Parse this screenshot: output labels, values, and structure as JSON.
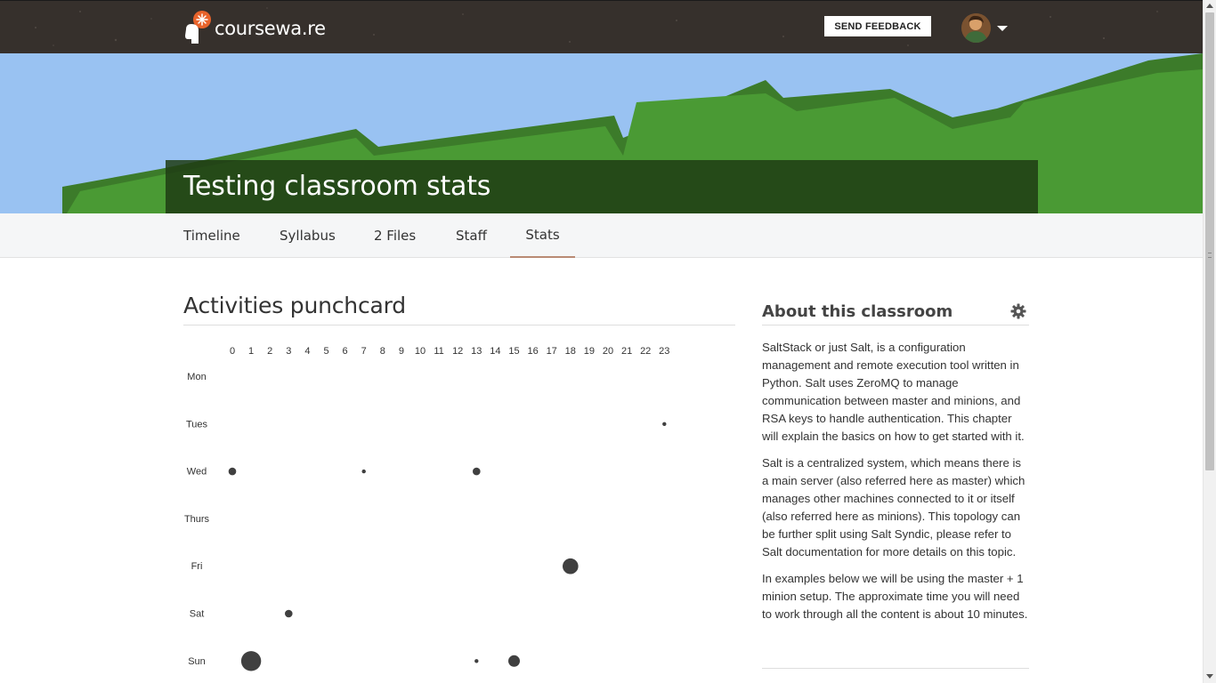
{
  "header": {
    "brand": "coursewa.re",
    "feedback_label": "SEND FEEDBACK",
    "brand_color": "#36302c",
    "accent_color": "#e8632b"
  },
  "hero": {
    "title": "Testing classroom stats"
  },
  "tabs": [
    {
      "label": "Timeline"
    },
    {
      "label": "Syllabus"
    },
    {
      "label": "2 Files"
    },
    {
      "label": "Staff"
    },
    {
      "label": "Stats",
      "active": true
    }
  ],
  "punchcard": {
    "title": "Activities punchcard"
  },
  "chart_data": {
    "type": "scatter",
    "title": "Activities punchcard",
    "x_ticks": [
      "0",
      "1",
      "2",
      "3",
      "4",
      "5",
      "6",
      "7",
      "8",
      "9",
      "10",
      "11",
      "12",
      "13",
      "14",
      "15",
      "16",
      "17",
      "18",
      "19",
      "20",
      "21",
      "22",
      "23"
    ],
    "y_labels": [
      "Mon",
      "Tues",
      "Wed",
      "Thurs",
      "Fri",
      "Sat",
      "Sun"
    ],
    "points": [
      {
        "day": "Tues",
        "hour": 23,
        "size": 1
      },
      {
        "day": "Wed",
        "hour": 0,
        "size": 2
      },
      {
        "day": "Wed",
        "hour": 7,
        "size": 1
      },
      {
        "day": "Wed",
        "hour": 13,
        "size": 2
      },
      {
        "day": "Fri",
        "hour": 18,
        "size": 4
      },
      {
        "day": "Sat",
        "hour": 3,
        "size": 2
      },
      {
        "day": "Sun",
        "hour": 1,
        "size": 5
      },
      {
        "day": "Sun",
        "hour": 13,
        "size": 1
      },
      {
        "day": "Sun",
        "hour": 15,
        "size": 3
      }
    ],
    "dot_color": "#404040"
  },
  "about": {
    "title": "About this classroom",
    "paragraphs": [
      "SaltStack or just Salt, is a configuration management and remote execution tool written in Python. Salt uses ZeroMQ to manage communication between master and minions, and RSA keys to handle authentication. This chapter will explain the basics on how to get started with it.",
      "Salt is a centralized system, which means there is a main server (also referred here as master) which manages other machines connected to it or itself (also referred here as minions). This topology can be further split using Salt Syndic, please refer to Salt documentation for more details on this topic.",
      "In examples below we will be using the master + 1 minion setup. The approximate time you will need to work through all the content is about 10 minutes."
    ]
  }
}
